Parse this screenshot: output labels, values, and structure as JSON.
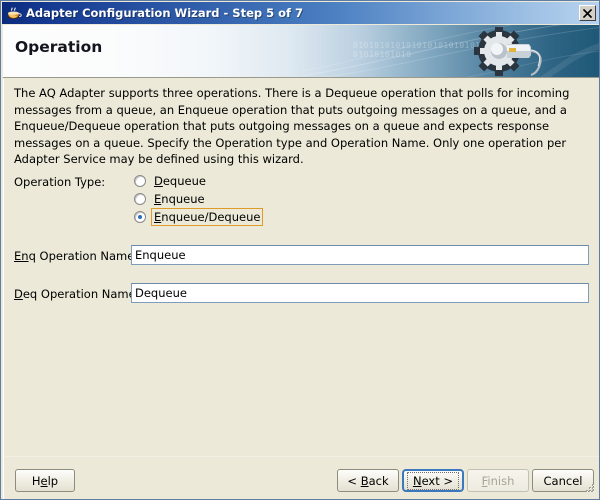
{
  "window": {
    "title": "Adapter Configuration Wizard - Step 5 of 7",
    "app_icon": "java-coffee-cup-icon",
    "close_label": "×",
    "accent_title_blue": "#13378f",
    "face_color": "#ece9d8"
  },
  "banner": {
    "heading": "Operation",
    "binary_line_1": "0101010101010101010101010101",
    "binary_line_2": "01010101010",
    "graphic": "gear-wrench-icon",
    "gradient_from": "#fdfdfd",
    "gradient_to": "#1f5877"
  },
  "main": {
    "description": "The AQ Adapter supports three operations.  There is a Dequeue operation that polls for incoming messages from a queue, an Enqueue operation that puts outgoing messages on a queue, and a Enqueue/Dequeue operation that puts outgoing messages on a queue and expects response messages on a queue.  Specify the Operation type and Operation Name. Only one operation per Adapter Service may be defined using this wizard.",
    "operation_type_label": "Operation Type:",
    "radios": [
      {
        "label": "Dequeue",
        "mnemonic": "D",
        "rest": "equeue",
        "checked": false,
        "focused": false
      },
      {
        "label": "Enqueue",
        "mnemonic": "E",
        "rest": "nqueue",
        "checked": false,
        "focused": false
      },
      {
        "label": "Enqueue/Dequeue",
        "mnemonic": "E",
        "rest": "nqueue/Dequeue",
        "checked": true,
        "focused": true
      }
    ],
    "enq_label_mnemonic": "En",
    "enq_label_rest": "q Operation Name:",
    "enq_value": "Enqueue",
    "deq_label_mnemonic": "D",
    "deq_label_rest": "eq Operation Name:",
    "deq_value": "Dequeue",
    "focus_outline_color": "#e09c28"
  },
  "buttons": {
    "help": {
      "pre": "H",
      "mn": "e",
      "post": "lp",
      "label": "Help",
      "enabled": true,
      "default": false
    },
    "back": {
      "pre": "< ",
      "mn": "B",
      "post": "ack",
      "label": "< Back",
      "enabled": true,
      "default": false
    },
    "next": {
      "pre": "",
      "mn": "N",
      "post": "ext >",
      "label": "Next >",
      "enabled": true,
      "default": true
    },
    "finish": {
      "pre": "",
      "mn": "F",
      "post": "inish",
      "label": "Finish",
      "enabled": false,
      "default": false
    },
    "cancel": {
      "pre": "",
      "mn": "",
      "post": "Cancel",
      "label": "Cancel",
      "enabled": true,
      "default": false
    }
  }
}
